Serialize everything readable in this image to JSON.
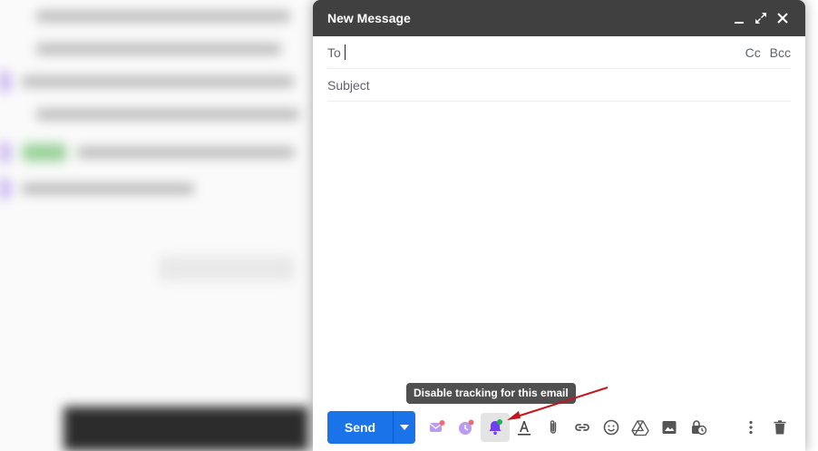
{
  "compose": {
    "title": "New Message",
    "to_label": "To",
    "cc_label": "Cc",
    "bcc_label": "Bcc",
    "subject_placeholder": "Subject",
    "send_label": "Send"
  },
  "tooltip": {
    "text": "Disable tracking for this email"
  },
  "toolbar_icons": [
    "mail-merge-icon",
    "schedule-send-icon",
    "tracking-bell-icon",
    "text-format-icon",
    "attach-icon",
    "link-icon",
    "emoji-icon",
    "drive-icon",
    "photo-icon",
    "confidential-mode-icon",
    "more-options-icon",
    "discard-icon"
  ],
  "colors": {
    "header_bg": "#404040",
    "send_blue": "#1a73e8",
    "tracking_purple": "#6f3ff5",
    "annotation_red": "#c4161c"
  }
}
